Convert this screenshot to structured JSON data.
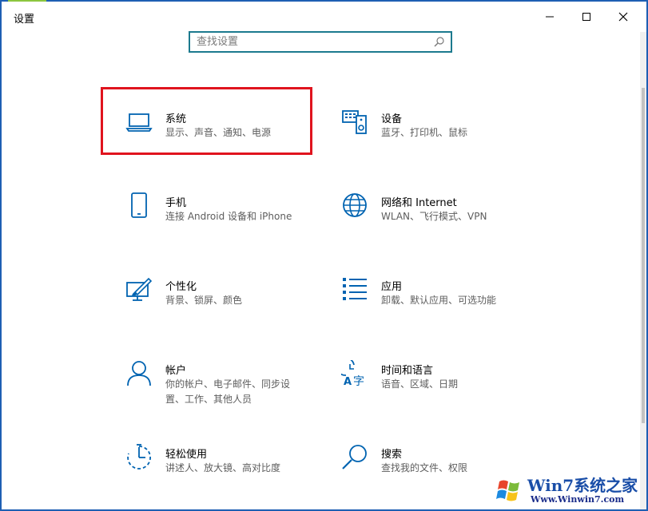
{
  "window": {
    "title": "设置"
  },
  "search": {
    "placeholder": "查找设置",
    "value": ""
  },
  "tiles": [
    {
      "label": "系统",
      "desc": "显示、声音、通知、电源"
    },
    {
      "label": "设备",
      "desc": "蓝牙、打印机、鼠标"
    },
    {
      "label": "手机",
      "desc": "连接 Android 设备和 iPhone"
    },
    {
      "label": "网络和 Internet",
      "desc": "WLAN、飞行模式、VPN"
    },
    {
      "label": "个性化",
      "desc": "背景、锁屏、颜色"
    },
    {
      "label": "应用",
      "desc": "卸载、默认应用、可选功能"
    },
    {
      "label": "帐户",
      "desc": "你的帐户、电子邮件、同步设置、工作、其他人员"
    },
    {
      "label": "时间和语言",
      "desc": "语音、区域、日期"
    },
    {
      "label": "轻松使用",
      "desc": "讲述人、放大镜、高对比度"
    },
    {
      "label": "搜索",
      "desc": "查找我的文件、权限"
    }
  ],
  "icons": {
    "system": "laptop-icon",
    "devices": "keyboard-speaker-icon",
    "phone": "phone-icon",
    "network": "globe-icon",
    "personalization": "paint-monitor-icon",
    "apps": "list-icon",
    "accounts": "person-icon",
    "time": "clock-language-icon",
    "ease": "timer-icon",
    "search": "magnifier-icon"
  },
  "colors": {
    "accent": "#0063b1",
    "highlight": "#e0141e",
    "search_border": "#1c7a8e"
  },
  "watermark": {
    "line1": "Win7系统之家",
    "line2": "Www.Winwin7.com"
  }
}
